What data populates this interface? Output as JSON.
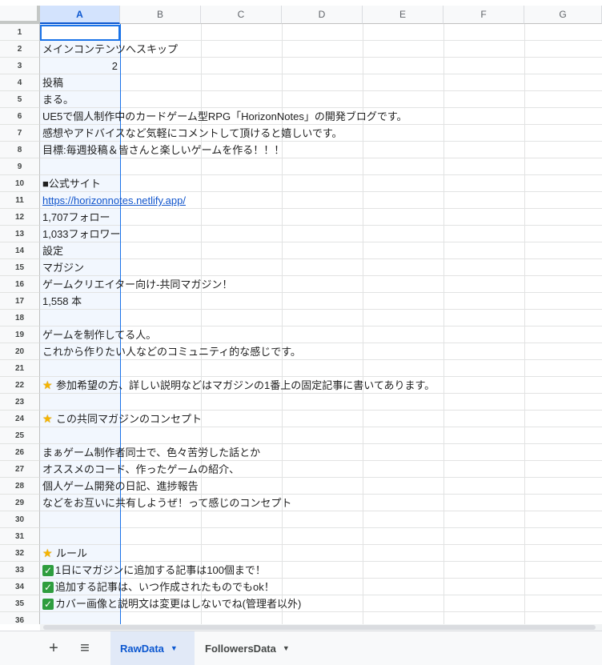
{
  "columns": [
    "A",
    "B",
    "C",
    "D",
    "E",
    "F",
    "G"
  ],
  "rows": [
    {
      "n": "1",
      "text": "",
      "type": "empty"
    },
    {
      "n": "2",
      "text": "メインコンテンツへスキップ",
      "type": "text"
    },
    {
      "n": "3",
      "text": "2",
      "type": "num"
    },
    {
      "n": "4",
      "text": "投稿",
      "type": "text"
    },
    {
      "n": "5",
      "text": "まる。",
      "type": "text"
    },
    {
      "n": "6",
      "text": "UE5で個人制作中のカードゲーム型RPG「HorizonNotes」の開発ブログです。",
      "type": "text"
    },
    {
      "n": "7",
      "text": "感想やアドバイスなど気軽にコメントして頂けると嬉しいです。",
      "type": "text"
    },
    {
      "n": "8",
      "text": "目標:毎週投稿＆皆さんと楽しいゲームを作る！！！",
      "type": "text"
    },
    {
      "n": "9",
      "text": "",
      "type": "empty"
    },
    {
      "n": "10",
      "text": "■公式サイト",
      "type": "text"
    },
    {
      "n": "11",
      "text": "https://horizonnotes.netlify.app/",
      "type": "link"
    },
    {
      "n": "12",
      "text": "1,707フォロー",
      "type": "text"
    },
    {
      "n": "13",
      "text": "1,033フォロワー",
      "type": "text"
    },
    {
      "n": "14",
      "text": "設定",
      "type": "text"
    },
    {
      "n": "15",
      "text": "マガジン",
      "type": "text"
    },
    {
      "n": "16",
      "text": "ゲームクリエイター向け-共同マガジン！",
      "type": "text"
    },
    {
      "n": "17",
      "text": "1,558 本",
      "type": "text"
    },
    {
      "n": "18",
      "text": "",
      "type": "empty"
    },
    {
      "n": "19",
      "text": "ゲームを制作してる人。",
      "type": "text"
    },
    {
      "n": "20",
      "text": "これから作りたい人などのコミュニティ的な感じです。",
      "type": "text"
    },
    {
      "n": "21",
      "text": "",
      "type": "empty"
    },
    {
      "n": "22",
      "text": "参加希望の方、詳しい説明などはマガジンの1番上の固定記事に書いてあります。",
      "type": "star"
    },
    {
      "n": "23",
      "text": "",
      "type": "empty"
    },
    {
      "n": "24",
      "text": "この共同マガジンのコンセプト",
      "type": "star"
    },
    {
      "n": "25",
      "text": "",
      "type": "empty"
    },
    {
      "n": "26",
      "text": "まぁゲーム制作者同士で、色々苦労した話とか",
      "type": "text"
    },
    {
      "n": "27",
      "text": "オススメのコード、作ったゲームの紹介、",
      "type": "text"
    },
    {
      "n": "28",
      "text": "個人ゲーム開発の日記、進捗報告",
      "type": "text"
    },
    {
      "n": "29",
      "text": "などをお互いに共有しようぜ！って感じのコンセプト",
      "type": "text"
    },
    {
      "n": "30",
      "text": "",
      "type": "empty"
    },
    {
      "n": "31",
      "text": "",
      "type": "empty"
    },
    {
      "n": "32",
      "text": "ルール",
      "type": "star"
    },
    {
      "n": "33",
      "text": "1日にマガジンに追加する記事は100個まで！",
      "type": "check"
    },
    {
      "n": "34",
      "text": "追加する記事は、いつ作成されたものでもok！",
      "type": "check"
    },
    {
      "n": "35",
      "text": "カバー画像と説明文は変更はしないでね(管理者以外)",
      "type": "check"
    },
    {
      "n": "36",
      "text": "",
      "type": "empty"
    }
  ],
  "sheet_tabs": [
    {
      "label": "RawData",
      "active": true
    },
    {
      "label": "FollowersData",
      "active": false
    }
  ],
  "toolbar": {
    "add_icon": "plus-icon",
    "menu_icon": "hamburger-icon"
  }
}
